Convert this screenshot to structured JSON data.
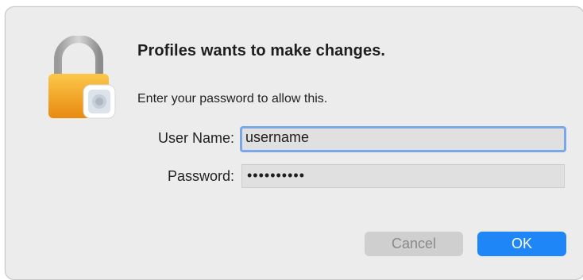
{
  "dialog": {
    "title": "Profiles wants to make changes.",
    "subtitle": "Enter your password to allow this.",
    "icon": "lock-icon"
  },
  "form": {
    "username_label": "User Name:",
    "username_value": "username",
    "password_label": "Password:",
    "password_value": "••••••••••"
  },
  "buttons": {
    "cancel_label": "Cancel",
    "ok_label": "OK"
  },
  "colors": {
    "accent": "#1f86f7",
    "focus_ring": "#7aa7e8",
    "lock_body": "#f5a623",
    "dialog_bg": "#ececec"
  }
}
